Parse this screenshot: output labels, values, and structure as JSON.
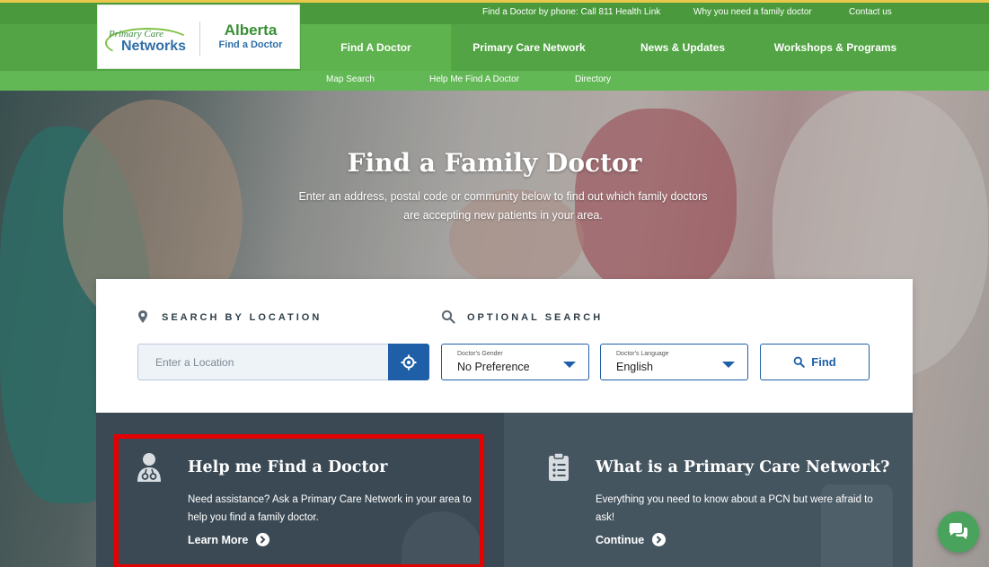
{
  "header": {
    "logo": {
      "pcn_small": "Primary Care",
      "pcn_big": "Networks",
      "title": "Alberta",
      "subtitle": "Find a Doctor"
    },
    "utility_links": [
      "Find a Doctor by phone: Call 811 Health Link",
      "Why you need a family doctor",
      "Contact us"
    ],
    "nav": [
      {
        "label": "Find A Doctor",
        "active": true
      },
      {
        "label": "Primary Care Network",
        "active": false
      },
      {
        "label": "News & Updates",
        "active": false
      },
      {
        "label": "Workshops & Programs",
        "active": false
      }
    ],
    "subnav": [
      "Map Search",
      "Help Me Find A Doctor",
      "Directory"
    ]
  },
  "hero": {
    "title": "Find a Family Doctor",
    "subtitle": "Enter an address, postal code or community below to find out which family doctors are accepting new patients in your area."
  },
  "search": {
    "location_heading": "SEARCH BY LOCATION",
    "optional_heading": "OPTIONAL SEARCH",
    "location_placeholder": "Enter a Location",
    "gender": {
      "label": "Doctor's Gender",
      "value": "No Preference"
    },
    "language": {
      "label": "Doctor's Language",
      "value": "English"
    },
    "find_label": "Find"
  },
  "panels": {
    "help": {
      "title": "Help me Find a Doctor",
      "description": "Need assistance? Ask a Primary Care Network in your area to help you find a family doctor.",
      "link": "Learn More"
    },
    "pcn": {
      "title": "What is a Primary Care Network?",
      "description": "Everything you need to know about a PCN but were afraid to ask!",
      "link": "Continue"
    }
  },
  "colors": {
    "brand_green": "#4a9a3d",
    "nav_active": "#5eb34f",
    "accent_blue": "#1f5fa8",
    "panel_dark": "#3a4954",
    "highlight": "#e40000",
    "chat_green": "#4aa35c"
  },
  "icons": {
    "location": "map-pin-icon",
    "search": "search-icon",
    "geolocate": "crosshair-icon",
    "doctor": "doctor-icon",
    "clipboard": "clipboard-list-icon",
    "arrow": "arrow-circle-right-icon",
    "chat": "chat-bubbles-icon"
  }
}
